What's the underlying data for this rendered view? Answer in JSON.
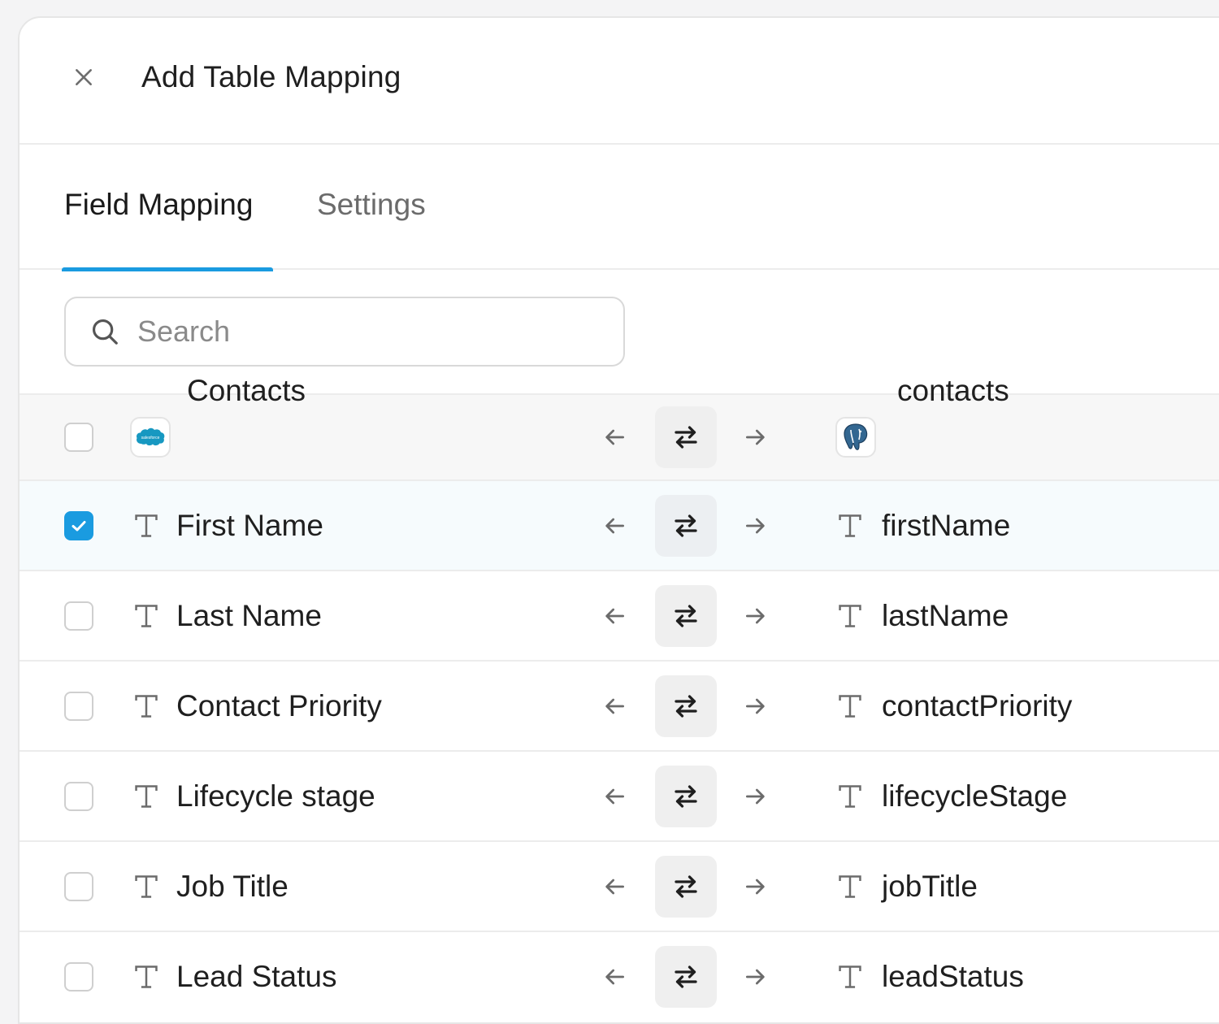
{
  "header": {
    "title": "Add Table Mapping"
  },
  "tabs": [
    {
      "label": "Field Mapping",
      "active": true
    },
    {
      "label": "Settings",
      "active": false
    }
  ],
  "search": {
    "placeholder": "Search",
    "value": ""
  },
  "table_header": {
    "source_label": "Contacts",
    "source_icon": "salesforce-logo",
    "source_logo_text": "salesforce",
    "dest_label": "contacts",
    "dest_icon": "postgresql-logo",
    "checked": false
  },
  "rows": [
    {
      "source": "First Name",
      "dest": "firstName",
      "checked": true
    },
    {
      "source": "Last Name",
      "dest": "lastName",
      "checked": false
    },
    {
      "source": "Contact Priority",
      "dest": "contactPriority",
      "checked": false
    },
    {
      "source": "Lifecycle stage",
      "dest": "lifecycleStage",
      "checked": false
    },
    {
      "source": "Job Title",
      "dest": "jobTitle",
      "checked": false
    },
    {
      "source": "Lead Status",
      "dest": "leadStatus",
      "checked": false
    }
  ],
  "colors": {
    "accent": "#1a9be0",
    "salesforce": "#1798c1",
    "postgres": "#336791"
  }
}
